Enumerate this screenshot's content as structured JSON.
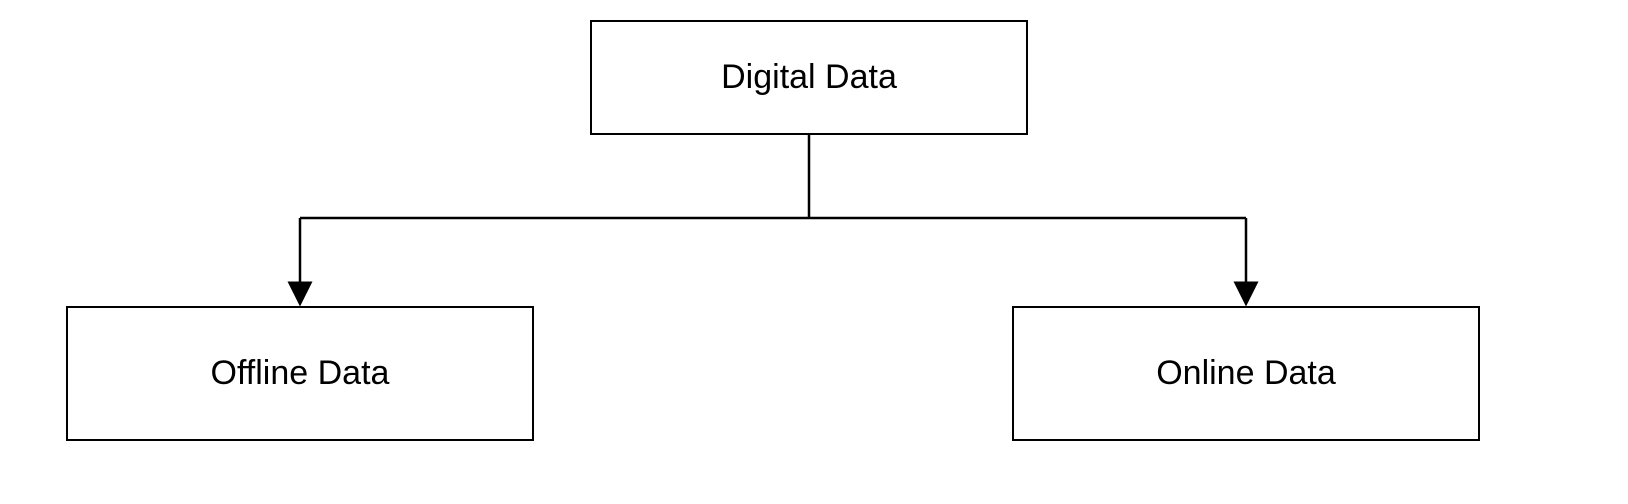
{
  "nodes": {
    "root": "Digital Data",
    "left": "Offline Data",
    "right": "Online Data"
  }
}
